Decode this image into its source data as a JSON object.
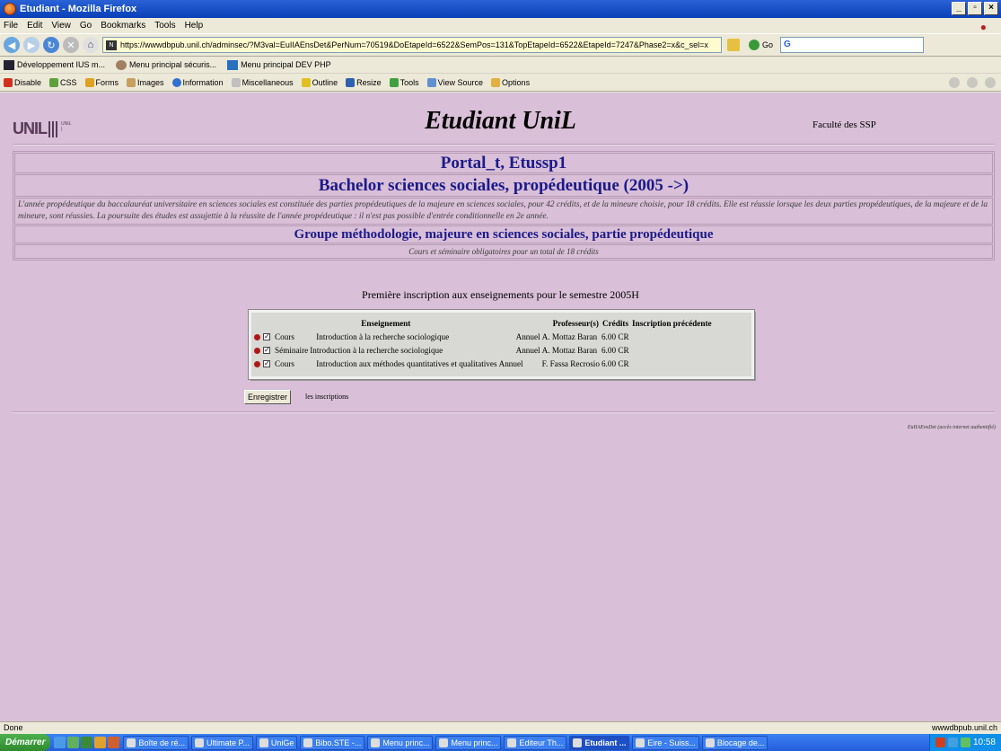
{
  "window": {
    "title": "Etudiant - Mozilla Firefox"
  },
  "menu": [
    "File",
    "Edit",
    "View",
    "Go",
    "Bookmarks",
    "Tools",
    "Help"
  ],
  "nav": {
    "url": "https://wwwdbpub.unil.ch/adminsec/?M3val=EuIIAEnsDet&PerNum=70519&DoEtapeId=6522&SemPos=131&TopEtapeId=6522&EtapeId=7247&Phase2=x&c_sel=x",
    "go_label": "Go",
    "search_value": "G"
  },
  "bookmarks": [
    "Développement IUS m...",
    "Menu principal sécuris...",
    "Menu principal DEV PHP"
  ],
  "webdev": [
    "Disable",
    "CSS",
    "Forms",
    "Images",
    "Information",
    "Miscellaneous",
    "Outline",
    "Resize",
    "Tools",
    "View Source",
    "Options"
  ],
  "page": {
    "title": "Etudiant UniL",
    "faculty": "Faculté des SSP",
    "portal": "Portal_t, Etussp1",
    "bachelor": "Bachelor sciences sociales, propédeutique (2005 ->)",
    "description": "L'année propédeutique du baccalauréat universitaire en sciences sociales est constituée des parties propédeutiques de la majeure en sciences sociales, pour 42 crédits, et de la mineure choisie, pour 18 crédits. Elle est réussie lorsque les deux parties propédeutiques, de la majeure et de la mineure, sont réussies. La poursuite des études est assujettie à la réussite de l'année propédeutique : il n'est pas possible d'entrée conditionnelle en 2e année.",
    "groupe": "Groupe méthodologie, majeure en sciences sociales, partie propédeutique",
    "cours_note": "Cours et séminaire obligatoires pour un total de 18 crédits",
    "premiere": "Première inscription aux enseignements pour le semestre 2005H",
    "table_headers": {
      "enseignement": "Enseignement",
      "professeurs": "Professeur(s)",
      "credits": "Crédits",
      "precedente": "Inscription précédente"
    },
    "rows": [
      {
        "type": "Cours",
        "titre": "Introduction à la recherche sociologique",
        "periode": "Annuel",
        "prof": "A. Mottaz Baran",
        "credits": "6.00 CR"
      },
      {
        "type": "Séminaire",
        "titre": "Introduction à la recherche sociologique",
        "periode": "Annuel",
        "prof": "A. Mottaz Baran",
        "credits": "6.00 CR"
      },
      {
        "type": "Cours",
        "titre": "Introduction aux méthodes quantitatives et qualitatives",
        "periode": "Annuel",
        "prof": "F. Fassa Recrosio",
        "credits": "6.00 CR"
      }
    ],
    "save_label": "Enregistrer",
    "save_suffix": "les inscriptions",
    "footer_link": "EuIIAEnsDet (accès internet authentifié)"
  },
  "status": {
    "text": "Done",
    "host": "wwwdbpub.unil.ch"
  },
  "taskbar": {
    "start": "Démarrer",
    "tasks": [
      "Boîte de ré...",
      "Ultimate P...",
      "UniGe",
      "Bibo.STE -...",
      "Menu princ...",
      "Menu princ...",
      "Editeur Th...",
      "Etudiant ...",
      "Eire - Suiss...",
      "Blocage de..."
    ],
    "clock": "10:58"
  }
}
